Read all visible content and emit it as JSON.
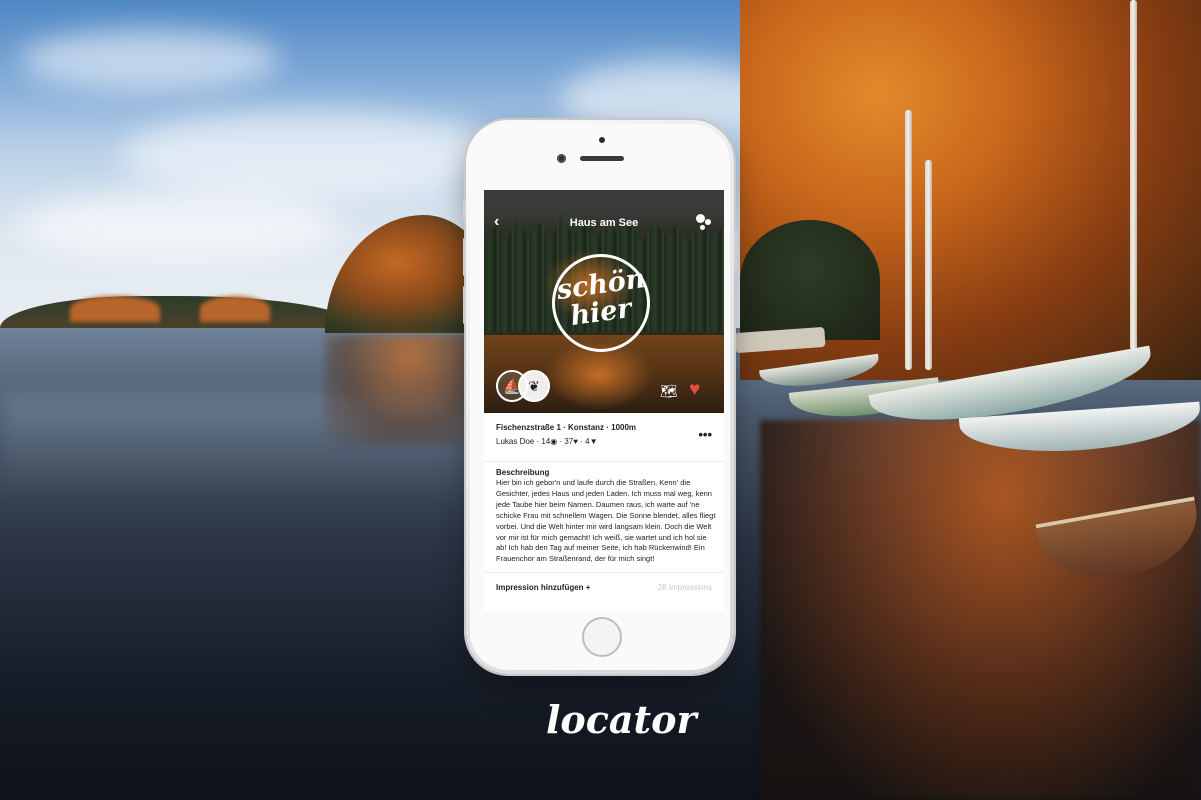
{
  "background": {
    "scene": "autumn lake with forest and rowing boats",
    "colors": {
      "sky": "#79a5d4",
      "foliage": "#e38a2c",
      "water": "#1a2230"
    }
  },
  "app": {
    "nav": {
      "back_icon": "chevron-left-icon",
      "title": "Haus am See",
      "more_icon": "bubbles-icon"
    },
    "hero": {
      "logo_line1": "schön",
      "logo_line2": "hier",
      "category_icons": [
        "boat-icon",
        "leaf-icon"
      ],
      "map_icon": "map-icon",
      "favorite_icon": "heart-icon",
      "favorite_color": "#e64b44"
    },
    "place": {
      "address": "Fischenzstraße 1 · Konstanz · 1000m",
      "author": "Lukas Doe",
      "views": "14",
      "likes": "37",
      "comments": "4",
      "more_label": "•••"
    },
    "description": {
      "heading": "Beschreibung",
      "text": "Hier bin ich gebor'n und laufe durch die Straßen, Kenn' die Gesichter, jedes Haus und jeden Laden. Ich muss mal weg, kenn jede Taube hier beim Namen. Daumen raus, ich warte auf 'ne schicke Frau mit schnellem Wagen. Die Sonne blendet, alles fliegt vorbei. Und die Welt hinter mir wird langsam klein. Doch die Welt vor mir ist für mich gemacht! Ich weiß, sie wartet und ich hol sie ab! Ich hab den Tag auf meiner Seite, ich hab Rückenwind! Ein Frauenchor am Straßenrand, der für mich singt!"
    },
    "footer": {
      "add_impression": "Impression hinzufügen +",
      "impressions_count": "28 Impressions"
    }
  },
  "brand": {
    "name": "locator"
  }
}
